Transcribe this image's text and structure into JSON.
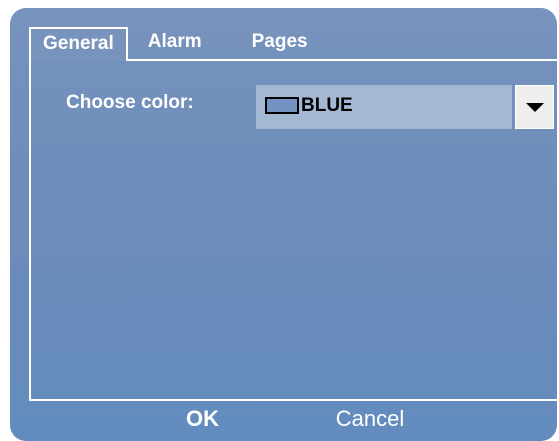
{
  "tabs": [
    {
      "label": "General"
    },
    {
      "label": "Alarm"
    },
    {
      "label": "Pages"
    }
  ],
  "active_tab": "General",
  "general": {
    "color_label": "Choose color:",
    "color_value": "BLUE",
    "swatch_color": "#7392c2"
  },
  "buttons": {
    "ok": "OK",
    "cancel": "Cancel"
  },
  "colors": {
    "dialog_top": "#7793bd",
    "dialog_bottom": "#628cbe",
    "combo_bg": "#a4b7d3",
    "text": "#ffffff"
  }
}
